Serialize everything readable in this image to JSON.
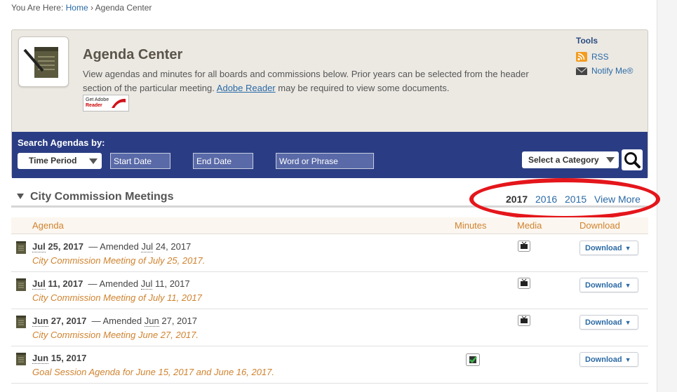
{
  "breadcrumb": {
    "prefix": "You Are Here:",
    "home": "Home",
    "separator": "›",
    "current": "Agenda Center"
  },
  "header": {
    "title": "Agenda Center",
    "desc_before": "View agendas and minutes for all boards and commissions below. Prior years can be selected from the header section of the particular meeting.",
    "desc_link": "Adobe Reader",
    "desc_after": "may be required to view some documents.",
    "adobe_line1": "Get Adobe",
    "adobe_line2": "Reader"
  },
  "tools": {
    "title": "Tools",
    "rss": "RSS",
    "notify": "Notify Me®"
  },
  "search": {
    "label": "Search Agendas by:",
    "time_period": "Time Period",
    "start_date": "Start Date",
    "end_date": "End Date",
    "word_phrase": "Word or Phrase",
    "category": "Select a Category"
  },
  "section": {
    "title": "City Commission Meetings",
    "years": [
      "2017",
      "2016",
      "2015"
    ],
    "view_more": "View More"
  },
  "columns": {
    "agenda": "Agenda",
    "minutes": "Minutes",
    "media": "Media",
    "download": "Download"
  },
  "rows": [
    {
      "mon": "Jul",
      "date": "25, 2017",
      "amended_label": "— Amended",
      "amended_mon": "Jul",
      "amended_date": "24, 2017",
      "title": "City Commission Meeting of July 25, 2017.",
      "download": "Download"
    },
    {
      "mon": "Jul",
      "date": "11, 2017",
      "amended_label": "— Amended",
      "amended_mon": "Jul",
      "amended_date": "11, 2017",
      "title": "City Commission Meeting of July 11, 2017",
      "download": "Download"
    },
    {
      "mon": "Jun",
      "date": "27, 2017",
      "amended_label": "— Amended",
      "amended_mon": "Jun",
      "amended_date": "27, 2017",
      "title": "City Commission Meeting June 27, 2017.",
      "download": "Download"
    },
    {
      "mon": "Jun",
      "date": "15, 2017",
      "title": "Goal Session Agenda for June 15, 2017 and June 16, 2017.",
      "download": "Download"
    }
  ],
  "colors": {
    "nav": "#2a3d84",
    "accent": "#d0832f",
    "link": "#2b6aa5",
    "highlight": "#e4161b"
  }
}
